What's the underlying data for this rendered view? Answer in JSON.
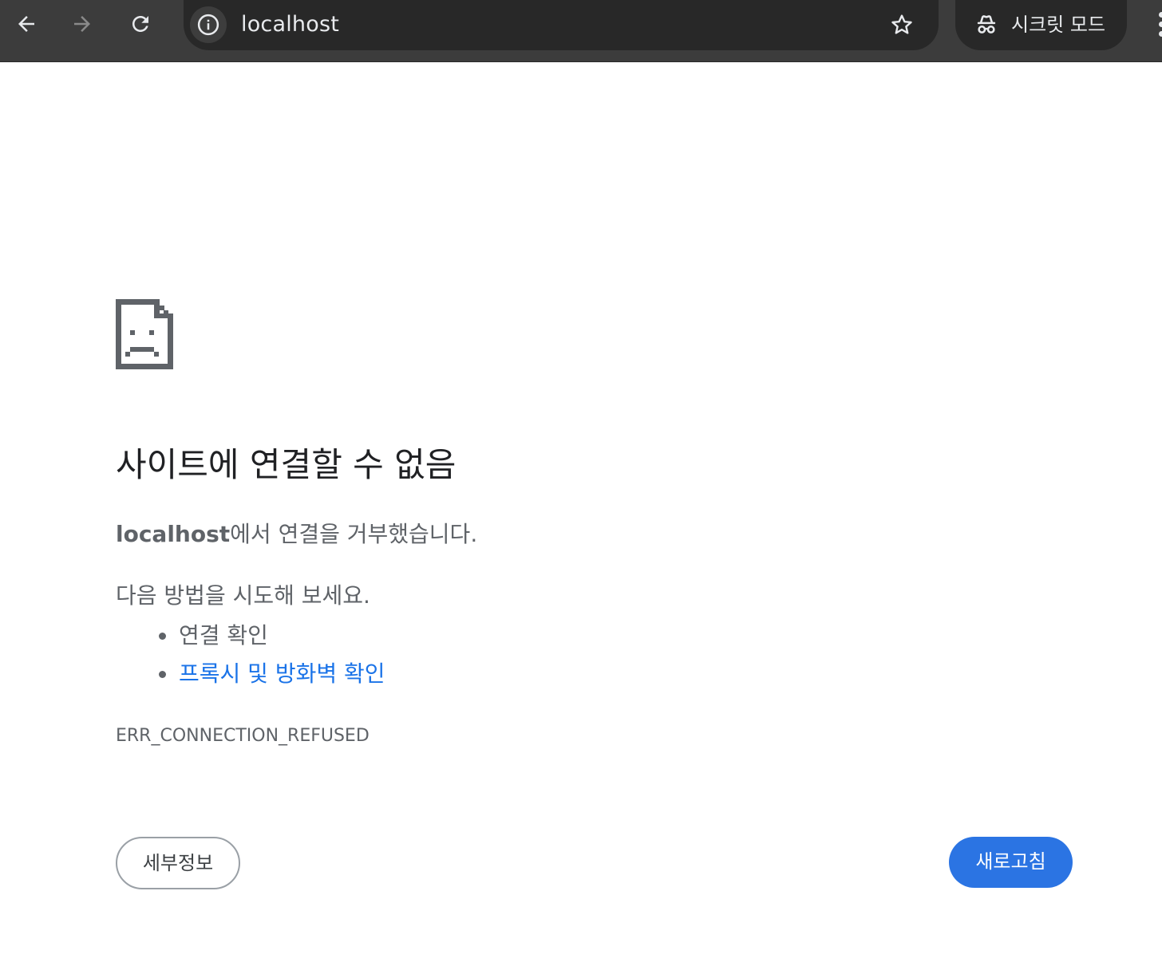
{
  "browser": {
    "url": "localhost",
    "incognito_label": "시크릿 모드",
    "icons": {
      "back": "back-arrow-icon",
      "forward": "forward-arrow-icon",
      "reload": "reload-icon",
      "site_info": "info-icon",
      "bookmark": "star-icon",
      "incognito": "incognito-icon",
      "menu": "more-vert-icon"
    }
  },
  "error_page": {
    "icon": "sad-document-icon",
    "title": "사이트에 연결할 수 없음",
    "host": "localhost",
    "message_suffix": "에서 연결을 거부했습니다.",
    "suggestions_heading": "다음 방법을 시도해 보세요.",
    "suggestions": [
      {
        "label": "연결 확인",
        "is_link": false
      },
      {
        "label": "프록시 및 방화벽 확인",
        "is_link": true
      }
    ],
    "error_code": "ERR_CONNECTION_REFUSED",
    "details_button": "세부정보",
    "reload_button": "새로고침"
  },
  "colors": {
    "toolbar_bg": "#3c3c3c",
    "omnibox_bg": "#282828",
    "link": "#1a73e8",
    "primary_button": "#2b74e3",
    "text_primary": "#202124",
    "text_secondary": "#5f6368"
  }
}
